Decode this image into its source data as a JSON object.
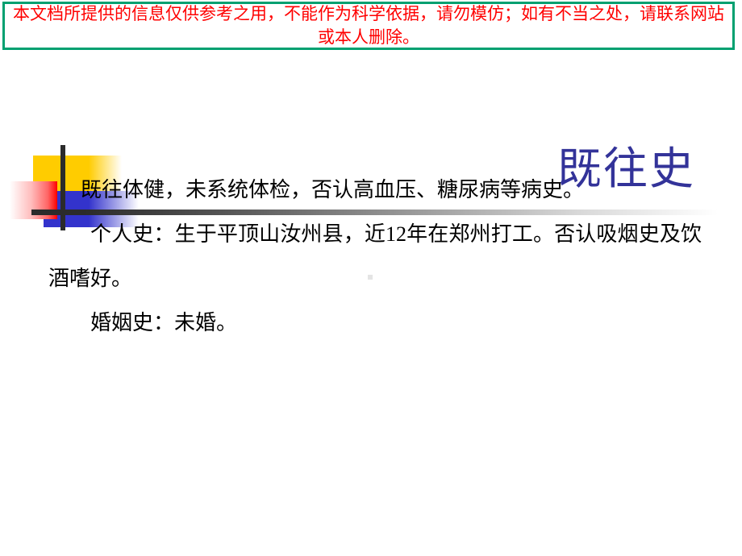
{
  "banner": {
    "text": "本文档所提供的信息仅供参考之用，不能作为科学依据，请勿模仿；如有不当之处，请联系网站或本人删除。",
    "text_color": "#ff0000",
    "border_color": "#00a070"
  },
  "slide": {
    "title": "既往史",
    "title_color": "#333399",
    "decoration": {
      "yellow": "#ffcc00",
      "blue": "#3333cc",
      "red": "#ff0000",
      "bar": "#2b2b2b"
    },
    "paragraphs": [
      "既往体健，未系统体检，否认高血压、糖尿病等病史。",
      "个人史：生于平顶山汝州县，近12年在郑州打工。否认吸烟史及饮酒嗜好。",
      "婚姻史：未婚。"
    ]
  }
}
